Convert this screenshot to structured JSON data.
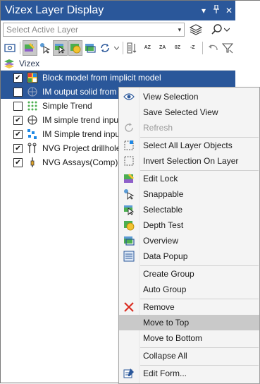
{
  "window": {
    "title": "Vizex Layer Display",
    "btn_dropdown": "▾",
    "btn_pin": "†",
    "btn_close": "✕"
  },
  "search": {
    "select_placeholder": "Select Active Layer",
    "caret": "▾"
  },
  "toolbar": {
    "sort_az": "AZ",
    "sort_za": "ZA",
    "sort_09": "0Z",
    "sort_minus": "-Z"
  },
  "tree": {
    "root_label": "Vizex",
    "rows": [
      {
        "label": "Block model from implicit model",
        "checked": "✔",
        "selected": true
      },
      {
        "label": "IM output solid from",
        "checked": "",
        "selected": true
      },
      {
        "label": "Simple Trend",
        "checked": "",
        "selected": false
      },
      {
        "label": "IM simple trend inpu",
        "checked": "✔",
        "selected": false
      },
      {
        "label": "IM Simple trend inpu",
        "checked": "✔",
        "selected": false
      },
      {
        "label": "NVG Project drillhole",
        "checked": "✔",
        "selected": false
      },
      {
        "label": "NVG Assays(Comp)",
        "checked": "✔",
        "selected": false
      }
    ]
  },
  "context_menu": {
    "items": [
      {
        "label": "View Selection",
        "icon": "eye-icon"
      },
      {
        "label": "Save Selected View",
        "icon": ""
      },
      {
        "label": "Refresh",
        "icon": "refresh-icon",
        "disabled": true
      },
      {
        "label": "Select All Layer Objects",
        "icon": "select-all-icon"
      },
      {
        "label": "Invert Selection On Layer",
        "icon": "invert-selection-icon"
      },
      {
        "label": "Edit Lock",
        "icon": "edit-lock-icon"
      },
      {
        "label": "Snappable",
        "icon": "snappable-icon"
      },
      {
        "label": "Selectable",
        "icon": "selectable-icon"
      },
      {
        "label": "Depth Test",
        "icon": "depth-test-icon"
      },
      {
        "label": "Overview",
        "icon": "overview-icon"
      },
      {
        "label": "Data Popup",
        "icon": "data-popup-icon"
      },
      {
        "label": "Create Group",
        "icon": ""
      },
      {
        "label": "Auto Group",
        "icon": ""
      },
      {
        "label": "Remove",
        "icon": "remove-icon"
      },
      {
        "label": "Move to Top",
        "icon": "",
        "highlighted": true
      },
      {
        "label": "Move to Bottom",
        "icon": ""
      },
      {
        "label": "Collapse All",
        "icon": ""
      },
      {
        "label": "Edit Form...",
        "icon": "edit-form-icon"
      }
    ]
  },
  "colors": {
    "accent": "#2a579a",
    "highlight": "#c9c9c9",
    "remove": "#d9281c"
  }
}
